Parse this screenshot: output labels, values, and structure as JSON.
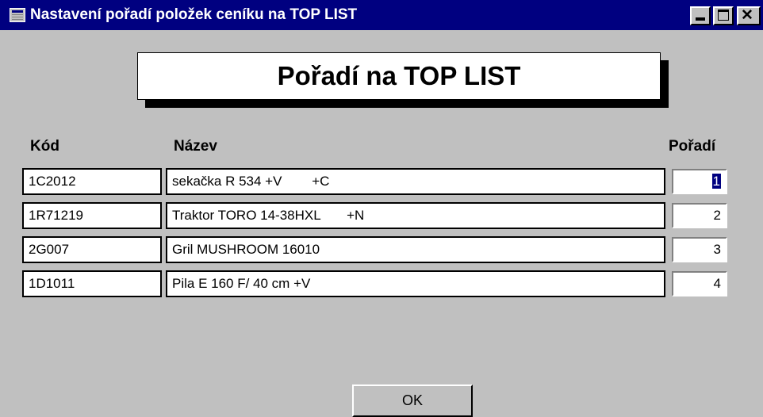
{
  "window": {
    "title": "Nastavení pořadí položek ceníku na TOP LIST",
    "icon": "form-icon",
    "controls": [
      "minimize-icon",
      "maximize-icon",
      "close-icon"
    ],
    "close_glyph": "✕"
  },
  "heading": "Pořadí na TOP LIST",
  "columns": {
    "code": "Kód",
    "name": "Název",
    "order": "Pořadí"
  },
  "rows": [
    {
      "code": "1C2012",
      "name": "sekačka R 534 +V        +C",
      "order": "1"
    },
    {
      "code": "1R71219",
      "name": "Traktor TORO 14-38HXL       +N",
      "order": "2"
    },
    {
      "code": "2G007",
      "name": "Gril MUSHROOM 16010",
      "order": "3"
    },
    {
      "code": "1D1011",
      "name": "Pila E 160 F/ 40 cm +V",
      "order": "4"
    }
  ],
  "ok_button": "OK",
  "colors": {
    "titlebar": "#000080",
    "face": "#c0c0c0",
    "selection": "#000080"
  }
}
